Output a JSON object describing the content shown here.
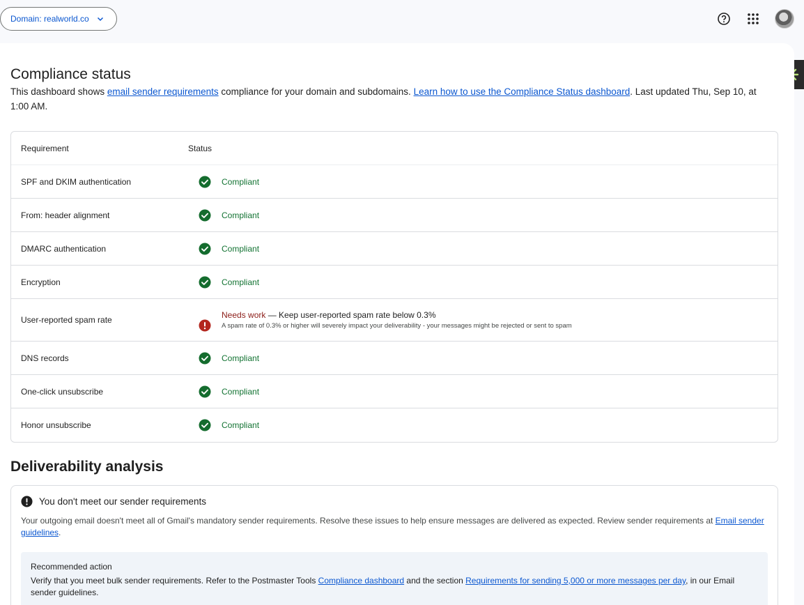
{
  "header": {
    "domain_label": "Domain: realworld.co",
    "icons": [
      "help-icon",
      "apps-grid-icon",
      "account-avatar",
      "extension-icon"
    ]
  },
  "compliance": {
    "title": "Compliance status",
    "intro_prefix": "This dashboard shows ",
    "intro_link1": "email sender requirements",
    "intro_mid": " compliance for your domain and subdomains. ",
    "intro_link2": "Learn how to use the Compliance Status dashboard",
    "intro_suffix": ". Last updated Thu, Sep 10, at 1:00 AM.",
    "columns": [
      "Requirement",
      "Status"
    ],
    "rows": [
      {
        "requirement": "SPF and DKIM authentication",
        "status": "Compliant"
      },
      {
        "requirement": "From: header alignment",
        "status": "Compliant"
      },
      {
        "requirement": "DMARC authentication",
        "status": "Compliant"
      },
      {
        "requirement": "Encryption",
        "status": "Compliant"
      },
      {
        "requirement": "User-reported spam rate",
        "status": "Needs work",
        "status_detail": " — Keep user-reported spam rate below 0.3%",
        "note": "A spam rate of 0.3% or higher will severely impact your deliverability - your messages might be rejected or sent to spam"
      },
      {
        "requirement": "DNS records",
        "status": "Compliant"
      },
      {
        "requirement": "One-click unsubscribe",
        "status": "Compliant"
      },
      {
        "requirement": "Honor unsubscribe",
        "status": "Compliant"
      }
    ]
  },
  "deliverability": {
    "title": "Deliverability analysis",
    "alert_title": "You don't meet our sender requirements",
    "body_prefix": "Your outgoing email doesn't meet all of Gmail's mandatory sender requirements. Resolve these issues to help ensure messages are delivered as expected. Review sender requirements at ",
    "body_link": "Email sender guidelines",
    "body_suffix": ".",
    "recommended": {
      "title": "Recommended action",
      "text_prefix": "Verify that you meet bulk sender requirements. Refer to the Postmaster Tools ",
      "link1": "Compliance dashboard",
      "text_mid": " and the section ",
      "link2": "Requirements for sending 5,000 or more messages per day",
      "text_suffix": ", in our Email sender guidelines."
    }
  },
  "colors": {
    "link": "#0b57d0",
    "compliant": "#137333",
    "needs_work": "#8c1d18",
    "check_icon": "#146c2e",
    "error_icon": "#b3261e"
  }
}
